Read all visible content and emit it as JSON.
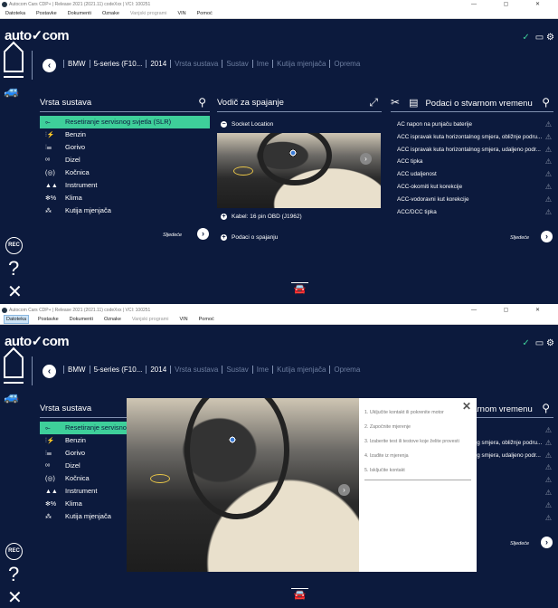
{
  "window": {
    "title": "Autocom Cars CDP+ | Release 2021 (2021.11) codeXxx | VCI: 100251",
    "menu": [
      "Datoteka",
      "Postavke",
      "Dokumenti",
      "Oznake",
      "Vanjski programi",
      "VIN",
      "Pomoć"
    ],
    "controls": "— ▢ ✕"
  },
  "header": {
    "logo": "auto✓com",
    "status_icon": "✓"
  },
  "breadcrumb": [
    "BMW",
    "5-series (F10...",
    "2014",
    "Vrsta sustava",
    "Sustav",
    "Ime",
    "Kutija mjenjača",
    "Oprema"
  ],
  "left": {
    "title": "Vrsta sustava",
    "items": [
      {
        "icon": "wrench-icon",
        "glyph": "⟜",
        "label": "Resetiranje servisnog svjetla (SLR)"
      },
      {
        "icon": "petrol-icon",
        "glyph": "⫶⚡",
        "label": "Benzin"
      },
      {
        "icon": "fuel-icon",
        "glyph": "⫶☰",
        "label": "Gorivo"
      },
      {
        "icon": "diesel-icon",
        "glyph": "ᵒᵒ",
        "label": "Dizel"
      },
      {
        "icon": "brake-icon",
        "glyph": "(◎)",
        "label": "Kočnica"
      },
      {
        "icon": "instrument-icon",
        "glyph": "▲▲",
        "label": "Instrument"
      },
      {
        "icon": "climate-icon",
        "glyph": "✻%",
        "label": "Klima"
      },
      {
        "icon": "gearbox-icon",
        "glyph": "⁂",
        "label": "Kutija mjenjača"
      }
    ],
    "next": "Sljedeće"
  },
  "middle": {
    "title": "Vodič za spajanje",
    "socket": "Socket Location",
    "cable": "Kabel: 16 pin OBD (J1962)",
    "conn": "Podaci o spajanju"
  },
  "right": {
    "title": "Podaci o stvarnom vremenu",
    "items": [
      "AC napon na punjaču baterije",
      "ACC ispravak kuta horizontalnog smjera, obližnje podru...",
      "ACC ispravak kuta horizontalnog smjera, udaljeno podr...",
      "ACC tipka",
      "ACC udaljenost",
      "ACC-okomiti kut korekcije",
      "ACC-vodoravni kut korekcije",
      "ACC/DCC tipka"
    ],
    "next": "Sljedeće"
  },
  "sidebar": {
    "rec": "REC",
    "help": "?",
    "close": "✕"
  },
  "modal": {
    "steps": [
      "1. Uključite kontakt ili pokrenite motor",
      "2. Započnite mjerenje",
      "3. Izaberite test ili testove koje želite provesti",
      "4. Izađite iz mjerenja",
      "5. Isključite kontakt"
    ],
    "close": "✕"
  }
}
